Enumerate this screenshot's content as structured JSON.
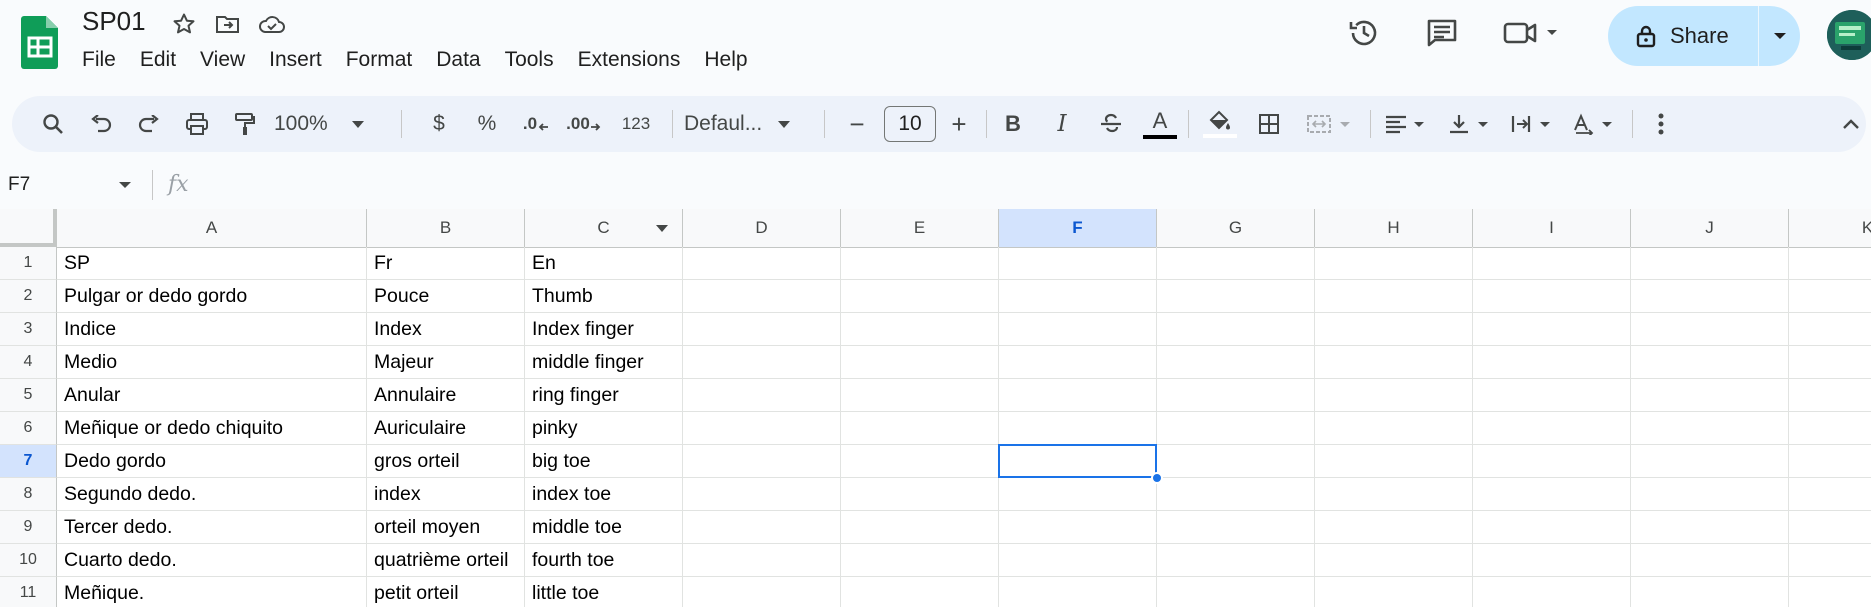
{
  "doc": {
    "title": "SP01"
  },
  "menu": [
    "File",
    "Edit",
    "View",
    "Insert",
    "Format",
    "Data",
    "Tools",
    "Extensions",
    "Help"
  ],
  "share": {
    "label": "Share"
  },
  "toolbar": {
    "zoom": "100%",
    "currency": "$",
    "percent": "%",
    "dec_decrease": ".0",
    "dec_increase": ".00",
    "number_format": "123",
    "font": "Defaul...",
    "font_size": "10",
    "minus": "−",
    "plus": "+",
    "bold": "B",
    "italic": "I",
    "text_color_glyph": "A"
  },
  "formula_bar": {
    "cell_ref": "F7",
    "fx": "fx",
    "value": ""
  },
  "grid": {
    "columns": [
      "A",
      "B",
      "C",
      "D",
      "E",
      "F",
      "G",
      "H",
      "I",
      "J",
      "K"
    ],
    "selected_column": "F",
    "selected_row": "7",
    "rows": [
      {
        "n": "1",
        "cells": [
          "SP",
          "Fr",
          "En"
        ]
      },
      {
        "n": "2",
        "cells": [
          "Pulgar or dedo gordo",
          "Pouce",
          "Thumb"
        ]
      },
      {
        "n": "3",
        "cells": [
          "Indice",
          "Index",
          "Index finger"
        ]
      },
      {
        "n": "4",
        "cells": [
          "Medio",
          "Majeur",
          "middle finger"
        ]
      },
      {
        "n": "5",
        "cells": [
          "Anular",
          "Annulaire",
          "ring finger"
        ]
      },
      {
        "n": "6",
        "cells": [
          "Meñique or dedo chiquito",
          "Auriculaire",
          "pinky"
        ]
      },
      {
        "n": "7",
        "cells": [
          "Dedo gordo",
          "gros orteil",
          "big toe"
        ]
      },
      {
        "n": "8",
        "cells": [
          "Segundo dedo.",
          "index",
          "index toe"
        ]
      },
      {
        "n": "9",
        "cells": [
          "Tercer dedo.",
          "orteil moyen",
          "middle toe"
        ]
      },
      {
        "n": "10",
        "cells": [
          "Cuarto dedo.",
          "quatrième orteil",
          "fourth toe"
        ]
      },
      {
        "n": "11",
        "cells": [
          "Meñique.",
          "petit orteil",
          "little toe"
        ]
      }
    ]
  },
  "colors": {
    "accent": "#1a73e8",
    "share_bg": "#c2e7ff",
    "logo_green": "#0f9d58"
  }
}
